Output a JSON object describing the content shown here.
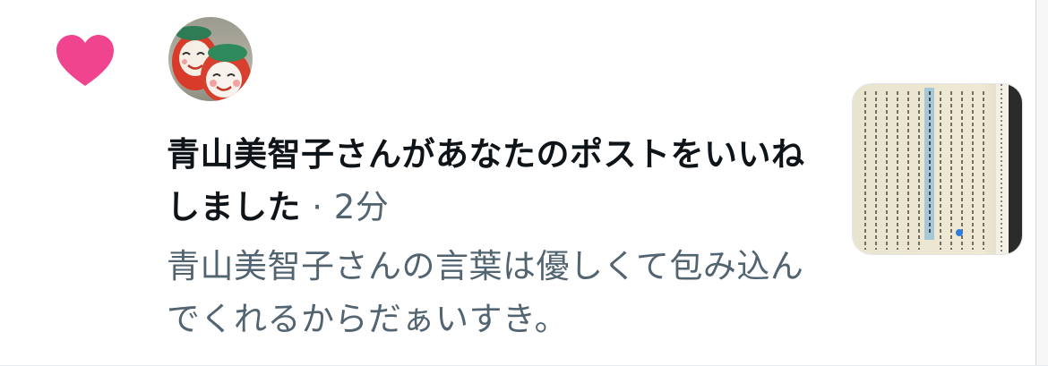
{
  "notification": {
    "type_icon": "heart-icon",
    "accent_color": "#f0448f",
    "avatar_icon": "avatar-daruma-image",
    "actor_name": "青山美智子",
    "action_text": "さんがあなたのポストをいいねしました",
    "separator": " · ",
    "time_ago": "2分",
    "post_excerpt": "青山美智子さんの言葉は優しくて包み込んでくれるからだぁいすき。",
    "thumbnail_icon": "book-page-photo"
  }
}
